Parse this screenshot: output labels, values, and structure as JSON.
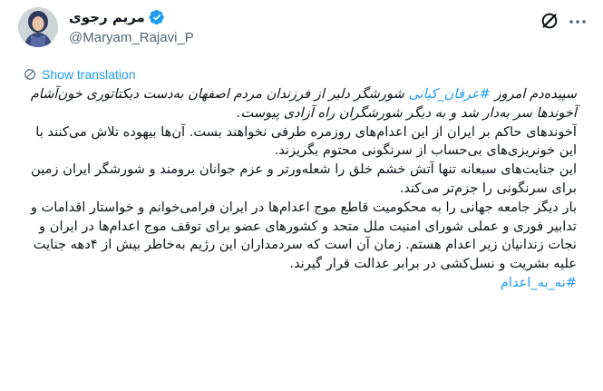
{
  "author": {
    "display_name": "مریم رجوی",
    "handle": "@Maryam_Rajavi_P",
    "verified": true
  },
  "translate": {
    "label": "Show translation"
  },
  "tweet": {
    "paragraph_1": {
      "prefix": "سپیده‌دم امروز ",
      "hashtag": "#عرفان_کیانی",
      "suffix": " شورشگر دلیر از فرزندان مردم اصفهان به‌دست دیکتاتوری خون‌آشام آخوندها سر به‌دار شد و به دیگر شورشگران راه آزادی پیوست."
    },
    "paragraph_2": "آخوندهای حاکم بر ایران از این اعدام‌های روزمره طرفی نخواهند بست. آن‌ها بیهوده تلاش می‌کنند با این خونریزی‌های بی‌حساب از سرنگونی محتوم بگریزند.",
    "paragraph_3": "این جنایت‌های سبعانه تنها آتش خشم خلق را شعله‌ورتر و عزم جوانان برومند و شورشگر ایران زمین برای سرنگونی را جزم‌تر می‌کند.",
    "paragraph_4": "بار دیگر جامعه جهانی را به محکومیت قاطع موج اعدام‌ها در ایران فرامی‌خوانم و خواستار اقدامات و تدابیر فوری و عملی شورای امنیت ملل متحد و کشورهای عضو برای توقف موج اعدام‌ها در ایران و نجات زندانیان زیر اعدام هستم. زمان آن است که سردمداران این رژیم به‌خاطر بیش از ۴دهه جنایت علیه بشریت و نسل‌کشی در برابر عدالت قرار گیرند.",
    "hashtag_final": "#نه_به_اعدام"
  },
  "colors": {
    "accent": "#1d9bf0",
    "text": "#0f1419",
    "muted": "#536471"
  },
  "icons": {
    "verified": "verified-badge-icon",
    "grok": "grok-icon",
    "more": "more-options-icon",
    "translate": "translate-globe-icon"
  }
}
